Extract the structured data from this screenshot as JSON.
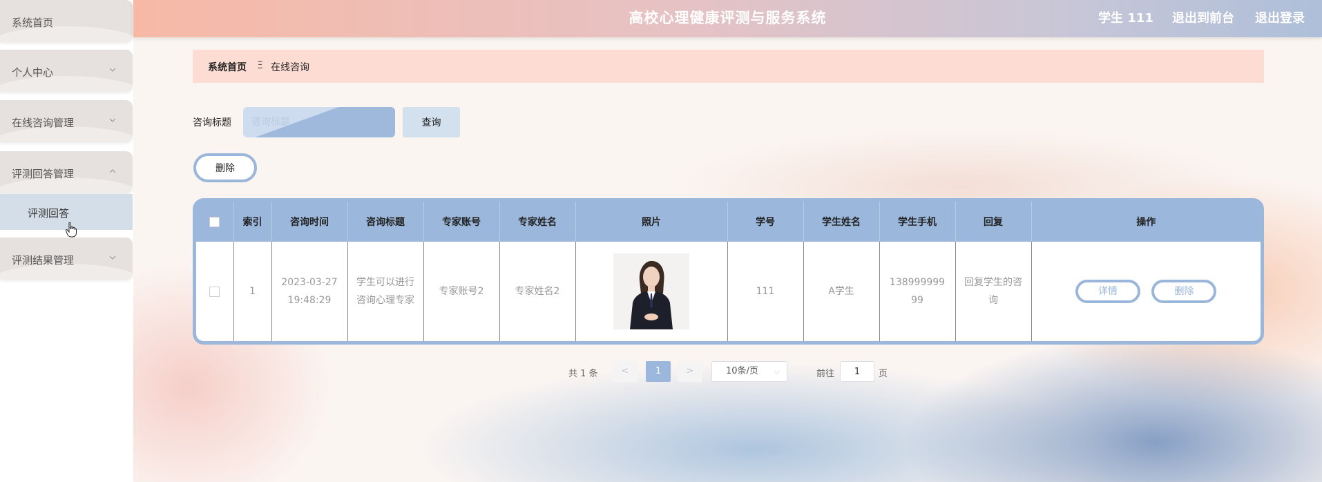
{
  "header": {
    "title": "高校心理健康评测与服务系统",
    "user": "学生 111",
    "link_front": "退出到前台",
    "link_logout": "退出登录"
  },
  "sidebar": {
    "items": [
      {
        "label": "系统首页"
      },
      {
        "label": "个人中心"
      },
      {
        "label": "在线咨询管理"
      },
      {
        "label": "评测回答管理"
      },
      {
        "label": "评测结果管理"
      }
    ],
    "submenu": {
      "label": "评测回答"
    }
  },
  "breadcrumb": {
    "home": "系统首页",
    "sep": "Ξ",
    "current": "在线咨询"
  },
  "search": {
    "label": "咨询标题",
    "placeholder": "咨询标题",
    "button": "查询"
  },
  "actions": {
    "delete": "删除"
  },
  "table": {
    "headers": [
      "索引",
      "咨询时间",
      "咨询标题",
      "专家账号",
      "专家姓名",
      "照片",
      "学号",
      "学生姓名",
      "学生手机",
      "回复",
      "操作"
    ],
    "rows": [
      {
        "index": "1",
        "time_line1": "2023-03-27",
        "time_line2": "19:48:29",
        "title": "学生可以进行咨询心理专家",
        "expert_account": "专家账号2",
        "expert_name": "专家姓名2",
        "student_id": "111",
        "student_name": "A学生",
        "phone_line1": "138999999",
        "phone_line2": "99",
        "reply": "回复学生的咨询",
        "btn_detail": "详情",
        "btn_delete": "删除"
      }
    ]
  },
  "pagination": {
    "total": "共 1 条",
    "prev": "<",
    "current": "1",
    "next": ">",
    "page_size": "10条/页",
    "goto_label": "前往",
    "goto_value": "1",
    "goto_suffix": "页"
  },
  "colors": {
    "accent": "#9bb8dc",
    "breadcrumb_bg": "#fcdcd3",
    "sidebar_item_bg": "#e6e1de",
    "submenu_bg": "#d3dee9"
  }
}
